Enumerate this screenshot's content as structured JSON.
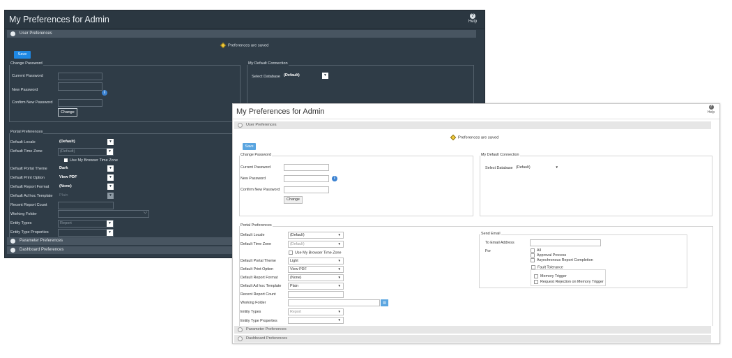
{
  "dark": {
    "title": "My Preferences for Admin",
    "help": "Help",
    "section_user": "User Preferences",
    "saved": "Preferences are saved",
    "save": "Save",
    "change_password": {
      "legend": "Change Password",
      "current": "Current Password",
      "new": "New Password",
      "confirm": "Confirm New Password",
      "change": "Change"
    },
    "default_connection": {
      "legend": "My Default Connection",
      "select_db": "Select Database",
      "db_value": "(Default)"
    },
    "portal": {
      "legend": "Portal Preferences",
      "locale": "Default Locale",
      "locale_val": "(Default)",
      "timezone": "Default Time Zone",
      "timezone_val": "(Default)",
      "browser_tz": "Use My Browser Time Zone",
      "theme": "Default Portal Theme",
      "theme_val": "Dark",
      "print": "Default Print Option",
      "print_val": "View PDF",
      "report_format": "Default Report Format",
      "report_format_val": "(None)",
      "adhoc": "Default Ad hoc Template",
      "adhoc_val": "Plain",
      "recent": "Recent Report Count",
      "working": "Working Folder",
      "entity_types": "Entity Types",
      "entity_types_val": "Report",
      "entity_props": "Entity Type Properties"
    },
    "section_param": "Parameter Preferences",
    "section_dash": "Dashboard Preferences"
  },
  "light": {
    "title": "My Preferences for Admin",
    "help": "Help",
    "section_user": "User Preferences",
    "saved": "Preferences are saved",
    "save": "Save",
    "change_password": {
      "legend": "Change Password",
      "current": "Current Password",
      "new": "New Password",
      "confirm": "Confirm New Password",
      "change": "Change"
    },
    "default_connection": {
      "legend": "My Default Connection",
      "select_db": "Select Database",
      "db_value": "(Default)"
    },
    "portal": {
      "legend": "Portal Preferences",
      "locale": "Default Locale",
      "locale_val": "(Default)",
      "timezone": "Default Time Zone",
      "timezone_val": "(Default)",
      "browser_tz": "Use My Browser Time Zone",
      "theme": "Default Portal Theme",
      "theme_val": "Light",
      "print": "Default Print Option",
      "print_val": "View PDF",
      "report_format": "Default Report Format",
      "report_format_val": "(None)",
      "adhoc": "Default Ad hoc Template",
      "adhoc_val": "Plain",
      "recent": "Recent Report Count",
      "working": "Working Folder",
      "entity_types": "Entity Types",
      "entity_types_val": "Report",
      "entity_props": "Entity Type Properties"
    },
    "send_email": {
      "legend": "Send Email",
      "to": "To Email Address",
      "for": "For",
      "all": "All",
      "approval": "Approval Process",
      "async": "Asynchronous Report Completion",
      "fault": "Fault Tolerance",
      "memory": "Memory Trigger",
      "rejection": "Request Rejection on Memory Trigger"
    },
    "section_param": "Parameter Preferences",
    "section_dash": "Dashboard Preferences"
  },
  "colors": {
    "dark_bg": "#2f3c47",
    "save_blue": "#1e88e5",
    "light_save_blue": "#5aa5e0"
  }
}
